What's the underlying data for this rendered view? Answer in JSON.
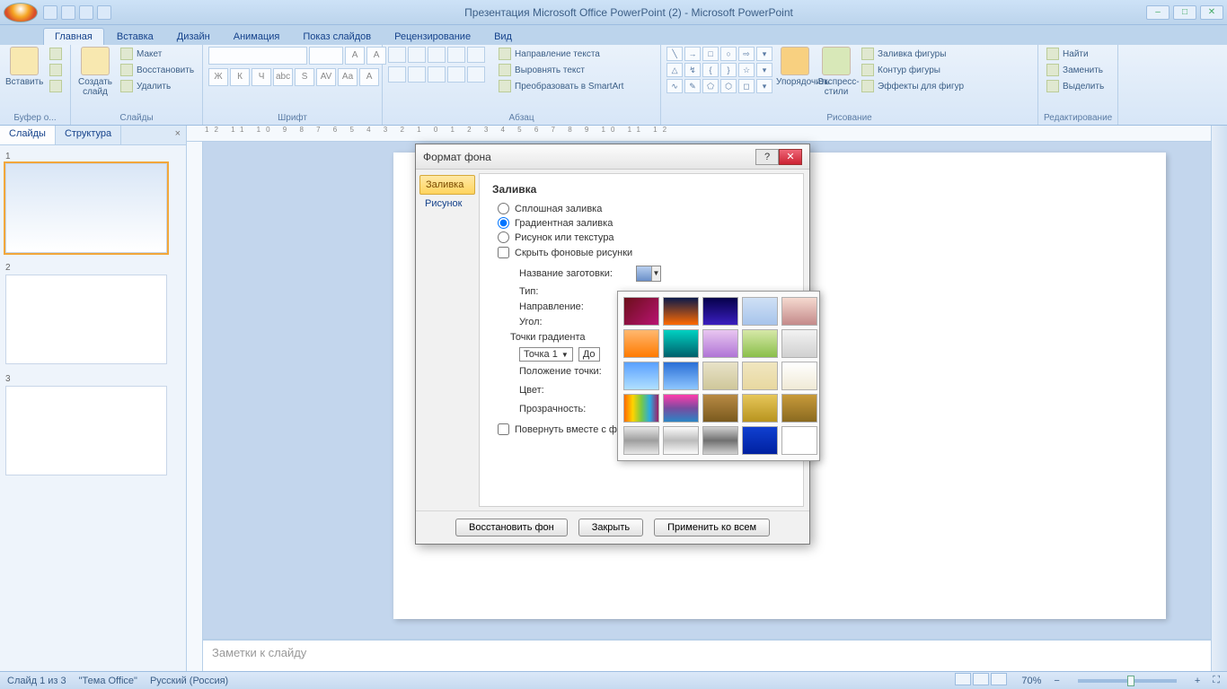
{
  "title": "Презентация Microsoft Office PowerPoint (2) - Microsoft PowerPoint",
  "tabs": [
    "Главная",
    "Вставка",
    "Дизайн",
    "Анимация",
    "Показ слайдов",
    "Рецензирование",
    "Вид"
  ],
  "activeTab": 0,
  "ribbon": {
    "clipboard": {
      "paste": "Вставить",
      "label": "Буфер о..."
    },
    "slides": {
      "new": "Создать слайд",
      "layout": "Макет",
      "reset": "Восстановить",
      "delete": "Удалить",
      "label": "Слайды"
    },
    "font": {
      "label": "Шрифт"
    },
    "paragraph": {
      "textdir": "Направление текста",
      "align": "Выровнять текст",
      "smartart": "Преобразовать в SmartArt",
      "label": "Абзац"
    },
    "drawing": {
      "arrange": "Упорядочить",
      "quick": "Экспресс-стили",
      "fill": "Заливка фигуры",
      "outline": "Контур фигуры",
      "effects": "Эффекты для фигур",
      "label": "Рисование"
    },
    "editing": {
      "find": "Найти",
      "replace": "Заменить",
      "select": "Выделить",
      "label": "Редактирование"
    }
  },
  "slidePanel": {
    "tabs": [
      "Слайды",
      "Структура"
    ],
    "slides": [
      "1",
      "2",
      "3"
    ]
  },
  "notes": "Заметки к слайду",
  "status": {
    "slide": "Слайд 1 из 3",
    "theme": "\"Тема Office\"",
    "lang": "Русский (Россия)",
    "zoom": "70%"
  },
  "dialog": {
    "title": "Формат фона",
    "nav": [
      "Заливка",
      "Рисунок"
    ],
    "heading": "Заливка",
    "radios": [
      "Сплошная заливка",
      "Градиентная заливка",
      "Рисунок или текстура"
    ],
    "hide": "Скрыть фоновые рисунки",
    "preset": "Название заготовки:",
    "type": "Тип:",
    "direction": "Направление:",
    "angle": "Угол:",
    "stops": "Точки градиента",
    "stopSel": "Точка 1",
    "add": "До",
    "stopPos": "Положение точки:",
    "color": "Цвет:",
    "transp": "Прозрачность:",
    "rotate": "Повернуть вместе с фигурой",
    "reset": "Восстановить фон",
    "close": "Закрыть",
    "applyAll": "Применить ко всем"
  },
  "presets": [
    "linear-gradient(135deg,#6b0f1a,#b91372)",
    "linear-gradient(#0b1a4a,#ff6a00)",
    "linear-gradient(#06004a,#3a1fbf)",
    "linear-gradient(#cfe0f5,#a7c4eb)",
    "linear-gradient(#f5d9cf,#c48a8a)",
    "linear-gradient(#ffb870,#ff7a00)",
    "linear-gradient(#00d1c1,#005f6b)",
    "linear-gradient(#e8c6f0,#b074d6)",
    "linear-gradient(#d6e8a8,#8abf4a)",
    "linear-gradient(#f2f2f2,#d0d0d0)",
    "linear-gradient(#5aa0ff,#b0e0ff)",
    "linear-gradient(#2a6fd6,#8ec6ff)",
    "linear-gradient(#e8e2c8,#cfc79a)",
    "linear-gradient(#f0e6c0,#e8d8a0)",
    "linear-gradient(#fff,#f0ead6)",
    "linear-gradient(90deg,#ff6a00,#ffd400,#7ac943,#29abe2,#9e1f63)",
    "linear-gradient(#ff3cac,#784ba0,#2b86c5)",
    "linear-gradient(#b88a44,#7a5a1e)",
    "linear-gradient(#e6c65a,#b8941e)",
    "linear-gradient(#c89a3a,#8a6a20)",
    "linear-gradient(#e6e6e6,#9e9e9e,#e6e6e6)",
    "linear-gradient(#fafafa,#bcbcbc,#fafafa)",
    "linear-gradient(#d0d0d0,#707070,#d0d0d0)",
    "linear-gradient(#1040d0,#0020a0)",
    "linear-gradient(#fff,#fff)"
  ]
}
